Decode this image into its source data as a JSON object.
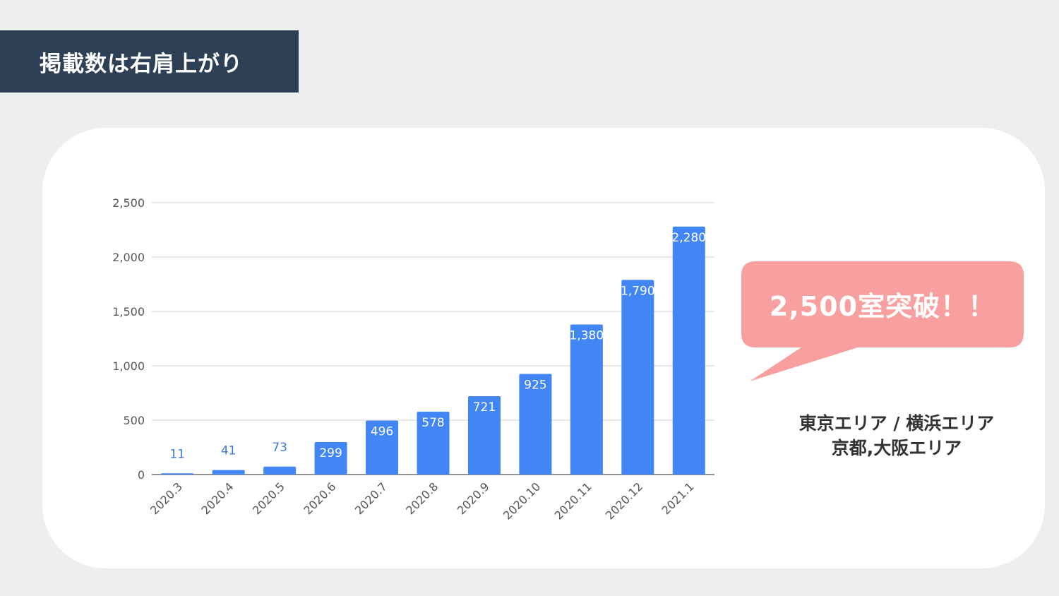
{
  "header": {
    "title": "掲載数は右肩上がり"
  },
  "callout": {
    "text": "2,500室突破！！",
    "color": "#f8a09f"
  },
  "areas": {
    "line1": "東京エリア / 横浜エリア",
    "line2": "京都,大阪エリア"
  },
  "chart_data": {
    "type": "bar",
    "categories": [
      "2020.3",
      "2020.4",
      "2020.5",
      "2020.6",
      "2020.7",
      "2020.8",
      "2020.9",
      "2020.10",
      "2020.11",
      "2020.12",
      "2021.1"
    ],
    "values": [
      11,
      41,
      73,
      299,
      496,
      578,
      721,
      925,
      1380,
      1790,
      2280
    ],
    "data_labels": [
      "11",
      "41",
      "73",
      "299",
      "496",
      "578",
      "721",
      "925",
      "1,380",
      "1,790",
      "2,280"
    ],
    "ylim": [
      0,
      2500
    ],
    "yticks": [
      0,
      500,
      1000,
      1500,
      2000,
      2500
    ],
    "ytick_labels": [
      "0",
      "500",
      "1,000",
      "1,500",
      "2,000",
      "2,500"
    ],
    "grid": true,
    "bar_color": "#4285f4",
    "title": "",
    "xlabel": "",
    "ylabel": ""
  }
}
